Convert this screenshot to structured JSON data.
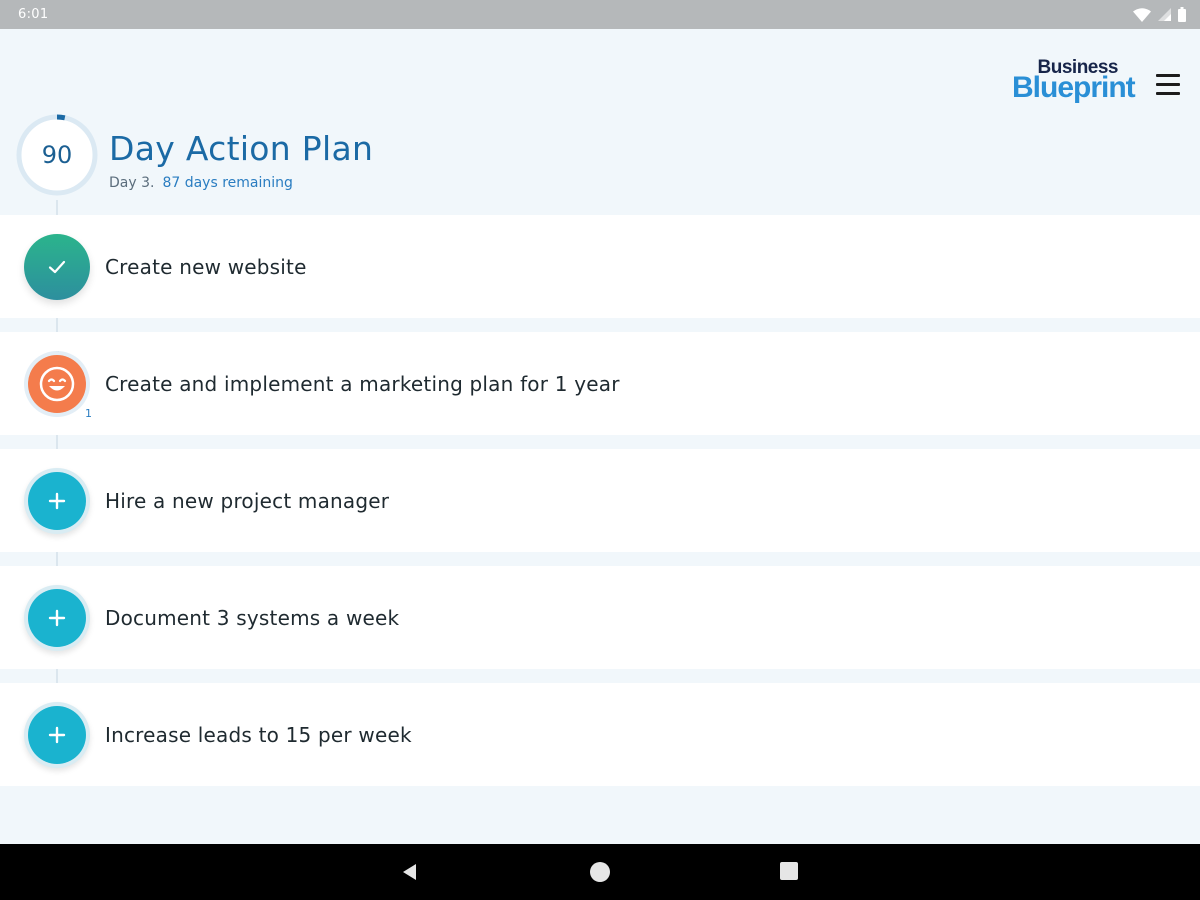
{
  "status_bar": {
    "time": "6:01"
  },
  "header": {
    "logo_top": "Business",
    "logo_bottom": "Blueprint",
    "day_counter": "90",
    "day_progress": 0.033,
    "title": "Day Action Plan",
    "day_label": "Day 3.",
    "remaining_label": "87 days remaining"
  },
  "tasks": [
    {
      "label": "Create new website",
      "state": "done",
      "icon": "check-icon"
    },
    {
      "label": "Create and implement a marketing plan for 1 year",
      "state": "active",
      "icon": "smile-face-icon",
      "badge": "1"
    },
    {
      "label": "Hire a new project manager",
      "state": "todo",
      "icon": "plus-icon"
    },
    {
      "label": "Document 3 systems a week",
      "state": "todo",
      "icon": "plus-icon"
    },
    {
      "label": "Increase leads to 15 per week",
      "state": "todo",
      "icon": "plus-icon"
    }
  ],
  "colors": {
    "accent": "#1b6aa5",
    "done": "#2bb48c",
    "active": "#f47c4c",
    "todo": "#1ab3cf"
  }
}
